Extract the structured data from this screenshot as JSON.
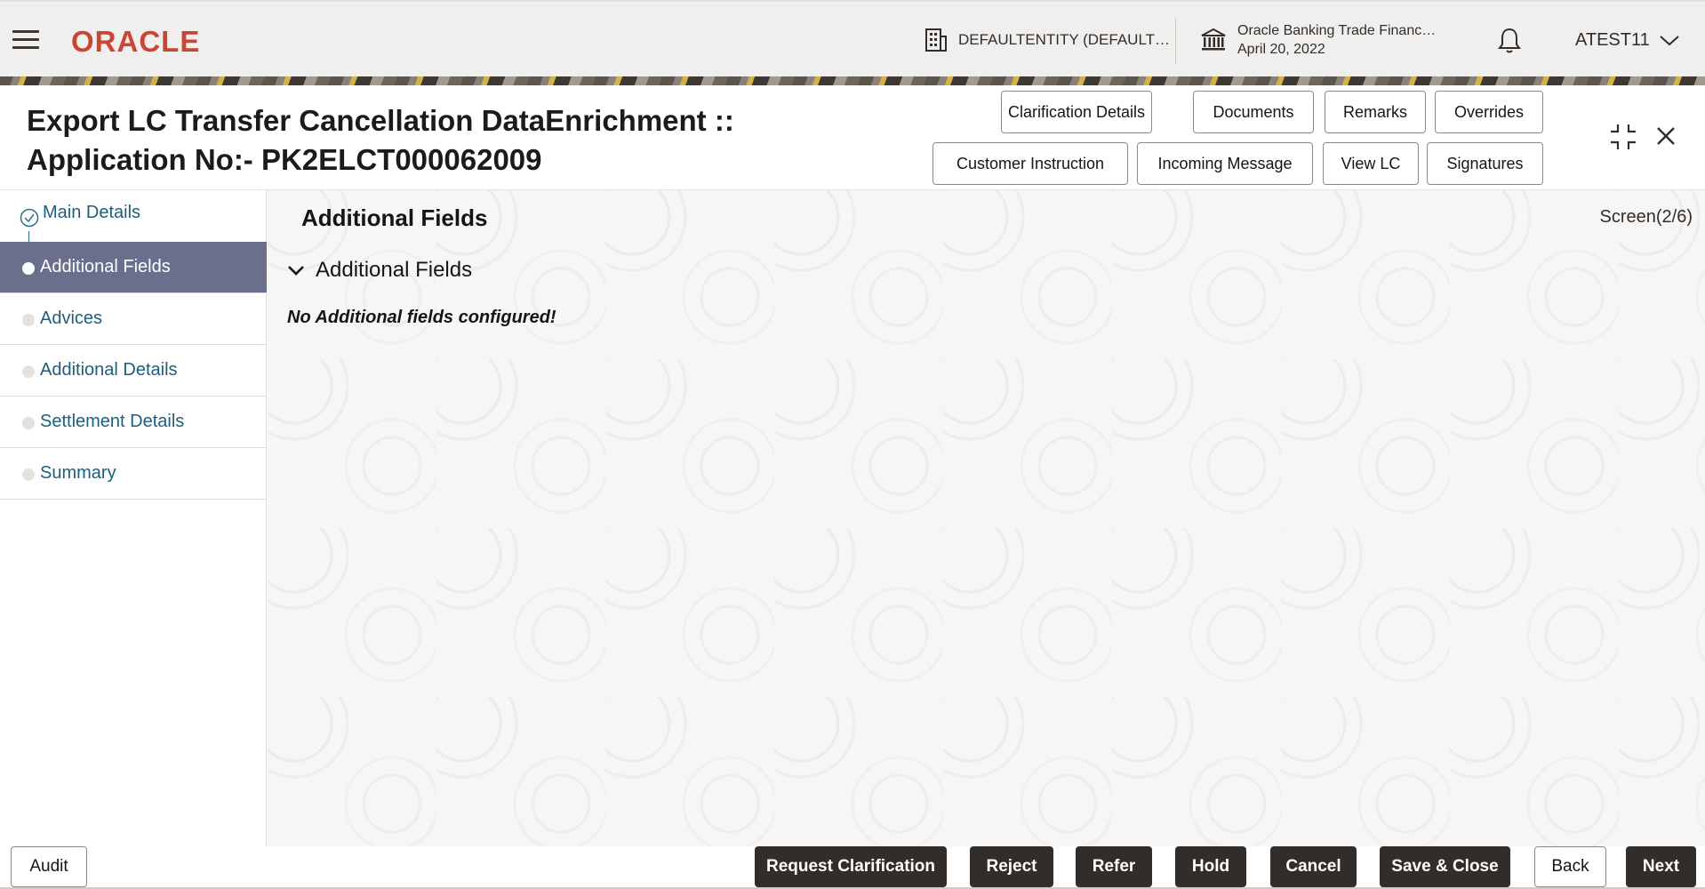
{
  "header": {
    "logo_text": "ORACLE",
    "entity_label": "DEFAULTENTITY (DEFAULT…",
    "bank_name": "Oracle Banking Trade Financ…",
    "bank_date": "April 20, 2022",
    "user_name": "ATEST11",
    "icons": [
      "menu-icon",
      "building-icon",
      "bank-icon",
      "bell-icon",
      "chevron-down-icon"
    ]
  },
  "title": {
    "line1": "Export LC Transfer Cancellation DataEnrichment ::",
    "line2": "Application No:- PK2ELCT000062009"
  },
  "toolbar": {
    "clarification_details": "Clarification Details",
    "documents": "Documents",
    "remarks": "Remarks",
    "overrides": "Overrides",
    "customer_instruction": "Customer Instruction",
    "incoming_message": "Incoming Message",
    "view_lc": "View LC",
    "signatures": "Signatures",
    "icons": [
      "collapse-icon",
      "close-icon"
    ]
  },
  "nav": {
    "items": [
      {
        "label": "Main Details",
        "state": "completed"
      },
      {
        "label": "Additional Fields",
        "state": "active"
      },
      {
        "label": "Advices",
        "state": "pending"
      },
      {
        "label": "Additional Details",
        "state": "pending"
      },
      {
        "label": "Settlement Details",
        "state": "pending"
      },
      {
        "label": "Summary",
        "state": "pending"
      }
    ]
  },
  "main": {
    "section_title": "Additional Fields",
    "screen_indicator": "Screen(2/6)",
    "panel_title": "Additional Fields",
    "empty_message": "No Additional fields configured!"
  },
  "footer": {
    "audit": "Audit",
    "request_clarification": "Request Clarification",
    "reject": "Reject",
    "refer": "Refer",
    "hold": "Hold",
    "cancel": "Cancel",
    "save_close": "Save & Close",
    "back": "Back",
    "next": "Next"
  },
  "colors": {
    "brand_red": "#c74634",
    "active_nav": "#6a6f8c",
    "primary_button": "#312d2a",
    "link_teal": "#1d5f7b"
  }
}
